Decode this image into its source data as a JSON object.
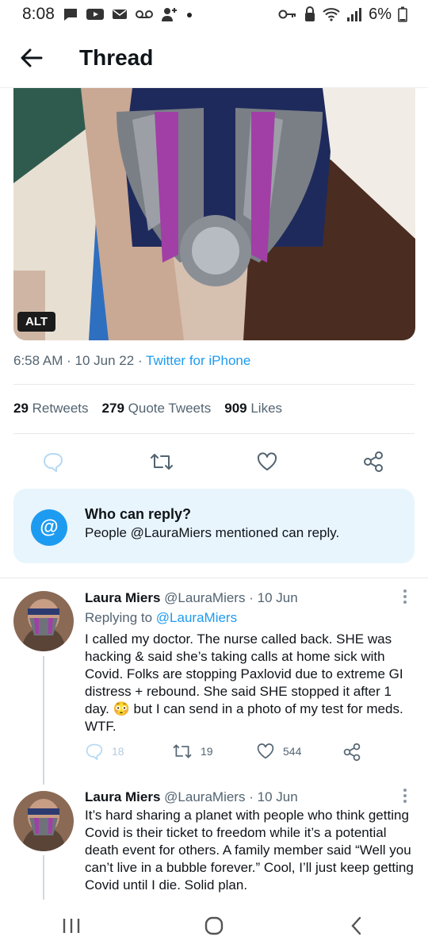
{
  "status_bar": {
    "time": "8:08",
    "battery": "6%"
  },
  "header": {
    "title": "Thread"
  },
  "media": {
    "alt_badge": "ALT"
  },
  "tweet_meta": {
    "time": "6:58 AM",
    "date": "10 Jun 22",
    "source": "Twitter for iPhone",
    "sep1": "·",
    "sep2": "·"
  },
  "stats": {
    "retweets_count": "29",
    "retweets_label": "Retweets",
    "quotes_count": "279",
    "quotes_label": "Quote Tweets",
    "likes_count": "909",
    "likes_label": "Likes"
  },
  "reply_restriction": {
    "icon": "@",
    "title": "Who can reply?",
    "text": "People @LauraMiers mentioned can reply."
  },
  "replies": [
    {
      "name": "Laura Miers",
      "handle": "@LauraMiers",
      "sep": "·",
      "date": "10 Jun",
      "replying_label": "Replying to",
      "replying_to": "@LauraMiers",
      "body": "I called my doctor. The nurse called back. SHE was hacking & said she’s taking calls at home sick with Covid. Folks are stopping Paxlovid due to extreme GI distress + rebound. She said SHE stopped it after 1 day. 😳 but I can send in a photo of my test for meds. WTF.",
      "reply_count": "18",
      "retweet_count": "19",
      "like_count": "544"
    },
    {
      "name": "Laura Miers",
      "handle": "@LauraMiers",
      "sep": "·",
      "date": "10 Jun",
      "body": "It’s hard sharing a planet with people who think getting Covid is their ticket to freedom while it’s a potential death event for others. A family member said “Well you can’t live in a bubble forever.” Cool, I’ll just keep getting Covid until I die. Solid plan."
    }
  ],
  "colors": {
    "accent": "#1d9bf0",
    "muted": "#536471",
    "reply_box_bg": "#e8f5fd"
  }
}
